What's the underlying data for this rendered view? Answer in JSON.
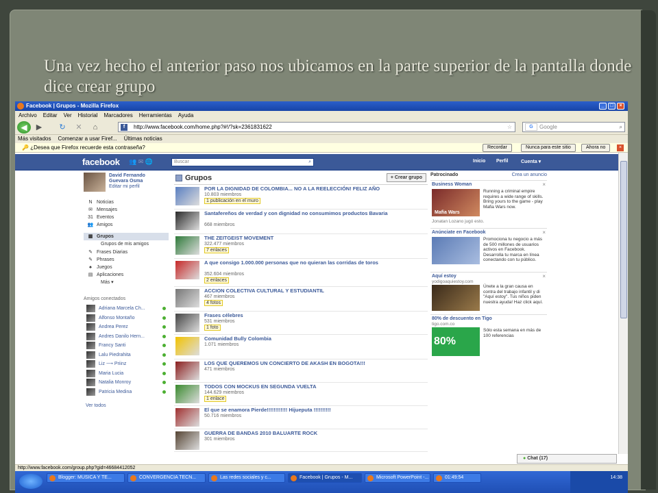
{
  "slide": {
    "title": "Una vez hecho el anterior paso nos ubicamos en la parte superior de la pantalla donde dice crear grupo"
  },
  "window": {
    "title": "Facebook | Grupos - Mozilla Firefox"
  },
  "menu": [
    "Archivo",
    "Editar",
    "Ver",
    "Historial",
    "Marcadores",
    "Herramientas",
    "Ayuda"
  ],
  "nav": {
    "url": "http://www.facebook.com/home.php?#!/?sk=2361831622",
    "search_placeholder": "Google"
  },
  "bookmarks": [
    "Más visitados",
    "Comenzar a usar Firef...",
    "Últimas noticias"
  ],
  "password_bar": {
    "question": "¿Desea que Firefox recuerde esta contraseña?",
    "remember": "Recordar",
    "never": "Nunca para este sitio",
    "not_now": "Ahora no"
  },
  "fb": {
    "logo": "facebook",
    "search_placeholder": "Buscar",
    "nav": [
      "Inicio",
      "Perfil",
      "Cuenta ▾"
    ],
    "profile": {
      "name1": "David Fernando",
      "name2": "Guevara Osma",
      "edit": "Editar mi perfil"
    },
    "left_nav": [
      {
        "label": "Noticias",
        "icon": "N"
      },
      {
        "label": "Mensajes",
        "icon": "✉"
      },
      {
        "label": "Eventos",
        "icon": "31"
      },
      {
        "label": "Amigos",
        "icon": "👥"
      },
      {
        "label": "Grupos",
        "icon": "▦"
      },
      {
        "label": "Grupos de mis amigos",
        "icon": ""
      },
      {
        "label": "Frases Diarias",
        "icon": "✎"
      },
      {
        "label": "Phrases",
        "icon": "✎"
      },
      {
        "label": "Juegos",
        "icon": "♠"
      },
      {
        "label": "Aplicaciones",
        "icon": "▤"
      },
      {
        "label": "Más ▾",
        "icon": ""
      }
    ],
    "friends_title": "Amigos conectados",
    "friends": [
      "Adriana Marcela Ch...",
      "Alfonso Montaño",
      "Andrea Perez",
      "Andres Danilo Hern...",
      "Francy Santi",
      "Lalu Piedrahita",
      "Liz ⟶ Priinz",
      "Maria Lucia",
      "Natalia Monroy",
      "Patricia Medina"
    ],
    "see_all": "Ver todos",
    "groups_title": "Grupos",
    "create_group": "+ Crear grupo",
    "groups": [
      {
        "name": "POR LA DIGNIDAD DE COLOMBIA... NO A LA REELECCIÓN! FELIZ AÑO",
        "members": "10.803 miembros",
        "badge": "1 publicación en el muro",
        "color": "#5a7fc1"
      },
      {
        "name": "Santafereños de verdad y con dignidad no consumimos productos Bavaria",
        "members": "668 miembros",
        "badge": "",
        "color": "#2a2a2a"
      },
      {
        "name": "THE ZEITGEIST MOVEMENT",
        "members": "322.477 miembros",
        "badge": "7 enlaces",
        "color": "#2f7a3a"
      },
      {
        "name": "A que consigo 1.000.000 personas que no quieran las corridas de toros",
        "members": "352.604 miembros",
        "badge": "2 enlaces",
        "color": "#c62828"
      },
      {
        "name": "ACCION COLECTIVA CULTURAL Y ESTUDIANTIL",
        "members": "467 miembros",
        "badge": "4 fotos",
        "color": "#777777"
      },
      {
        "name": "Frases célebres",
        "members": "531 miembros",
        "badge": "1 foto",
        "color": "#444444"
      },
      {
        "name": "Comunidad Bully Colombia",
        "members": "1.071 miembros",
        "badge": "",
        "color": "#f2c200"
      },
      {
        "name": "LOS QUE QUEREMOS UN CONCIERTO DE AKASH EN BOGOTA!!!",
        "members": "471 miembros",
        "badge": "",
        "color": "#8b1f1f"
      },
      {
        "name": "TODOS CON MOCKUS EN SEGUNDA VUELTA",
        "members": "144.629 miembros",
        "badge": "1 enlace",
        "color": "#3a8a2e"
      },
      {
        "name": "El que se enamora Pierde!!!!!!!!!!!! Hijueputa !!!!!!!!!!",
        "members": "50.716 miembros",
        "badge": "",
        "color": "#a03030"
      },
      {
        "name": "GUERRA DE BANDAS 2010 BALUARTE ROCK",
        "members": "301 miembros",
        "badge": "",
        "color": "#554433"
      }
    ],
    "sponsored": "Patrocinado",
    "create_ad": "Crea un anuncio",
    "ads": [
      {
        "title": "Business Woman",
        "source": "",
        "text": "Running a criminal empire requires a wide range of skills. Bring yours to the game - play Mafia Wars now.",
        "footer": "Jonatan Lozano jugó esto.",
        "img_label": "Mafia Wars"
      },
      {
        "title": "Anúnciate en Facebook",
        "source": "",
        "text": "Promociona tu negocio a más de 500 millones de usuarios activos en Facebook. Desarrolla tu marca en línea conectando con tu público.",
        "footer": "",
        "img_label": ""
      },
      {
        "title": "Aquí estoy",
        "source": "yodigoaquiestoy.com",
        "text": "Únete a la gran causa en contra del trabajo infantil y di \"Aquí estoy\". Tus niños piden nuestra ayuda! Haz click aquí.",
        "footer": "",
        "img_label": ""
      },
      {
        "title": "80% de descuento en Tigo",
        "source": "tigo.com.co",
        "text": "Sólo esta semana en más de 100 referencias",
        "footer": "",
        "img_label": "80%"
      }
    ],
    "chat": "Chat (17)"
  },
  "status_url": "http://www.facebook.com/group.php?gid=46684412052",
  "taskbar": {
    "items": [
      "Blogger: MUSICA Y TE...",
      "CONVERGENCIA TECN...",
      "Las redes sociales y c...",
      "Facebook | Grupos - M...",
      "Microsoft PowerPoint -...",
      "01:49:54"
    ],
    "clock": "14:38"
  }
}
